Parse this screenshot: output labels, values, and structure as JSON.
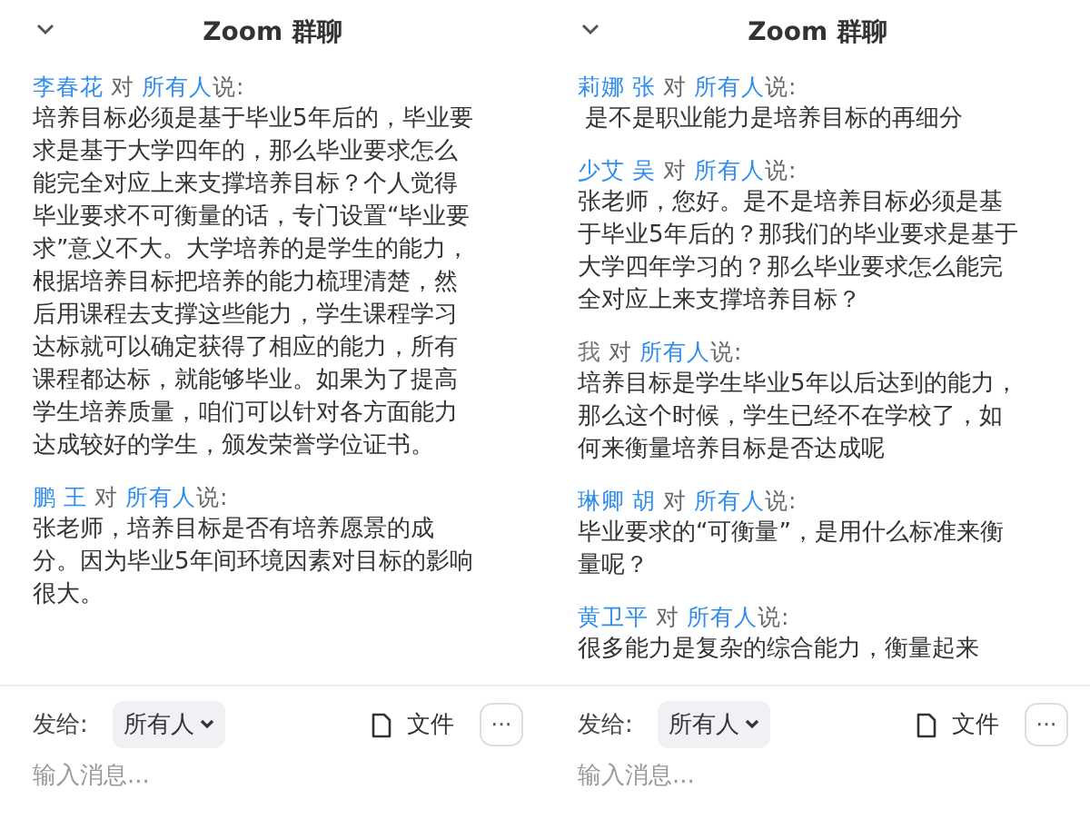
{
  "panels": [
    {
      "title": "Zoom 群聊",
      "messages": [
        {
          "kind": "other",
          "sender": "李春花",
          "to_word": "对",
          "recipient": "所有人",
          "said": "说:",
          "text": "培养目标必须是基于毕业5年后的，毕业要求是基于大学四年的，那么毕业要求怎么能完全对应上来支撑培养目标？个人觉得毕业要求不可衡量的话，专门设置“毕业要求”意义不大。大学培养的是学生的能力，根据培养目标把培养的能力梳理清楚，然后用课程去支撑这些能力，学生课程学习达标就可以确定获得了相应的能力，所有课程都达标，就能够毕业。如果为了提高学生培养质量，咱们可以针对各方面能力达成较好的学生，颁发荣誉学位证书。"
        },
        {
          "kind": "other",
          "sender": "鹏 王",
          "to_word": "对",
          "recipient": "所有人",
          "said": "说:",
          "text": "张老师，培养目标是否有培养愿景的成分。因为毕业5年间环境因素对目标的影响很大。"
        }
      ],
      "compose": {
        "label": "发给:",
        "recipient": "所有人",
        "file": "文件",
        "more": "···",
        "placeholder": "输入消息..."
      }
    },
    {
      "title": "Zoom 群聊",
      "messages": [
        {
          "kind": "other",
          "sender": "莉娜 张",
          "to_word": "对",
          "recipient": "所有人",
          "said": "说:",
          "text": " 是不是职业能力是培养目标的再细分"
        },
        {
          "kind": "other",
          "sender": "少艾 吴",
          "to_word": "对",
          "recipient": "所有人",
          "said": "说:",
          "text": "张老师，您好。是不是培养目标必须是基于毕业5年后的？那我们的毕业要求是基于大学四年学习的？那么毕业要求怎么能完全对应上来支撑培养目标？"
        },
        {
          "kind": "self",
          "sender": "我",
          "to_word": "对",
          "recipient": "所有人",
          "said": "说:",
          "text": "培养目标是学生毕业5年以后达到的能力，那么这个时候，学生已经不在学校了，如何来衡量培养目标是否达成呢"
        },
        {
          "kind": "other",
          "sender": "琳卿 胡",
          "to_word": "对",
          "recipient": "所有人",
          "said": "说:",
          "text": "毕业要求的“可衡量”，是用什么标准来衡量呢？"
        },
        {
          "kind": "other",
          "sender": "黄卫平",
          "to_word": "对",
          "recipient": "所有人",
          "said": "说:",
          "text": "很多能力是复杂的综合能力，衡量起来"
        }
      ],
      "compose": {
        "label": "发给:",
        "recipient": "所有人",
        "file": "文件",
        "more": "···",
        "placeholder": "输入消息..."
      }
    }
  ]
}
